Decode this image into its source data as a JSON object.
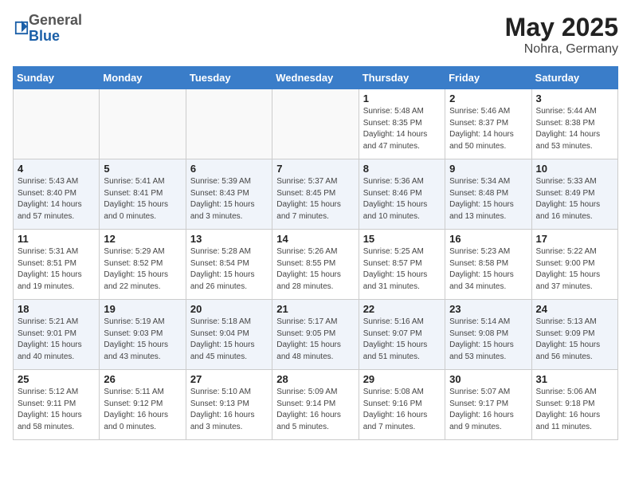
{
  "header": {
    "logo_general": "General",
    "logo_blue": "Blue",
    "title": "May 2025",
    "subtitle": "Nohra, Germany"
  },
  "weekdays": [
    "Sunday",
    "Monday",
    "Tuesday",
    "Wednesday",
    "Thursday",
    "Friday",
    "Saturday"
  ],
  "weeks": [
    [
      {
        "day": "",
        "info": ""
      },
      {
        "day": "",
        "info": ""
      },
      {
        "day": "",
        "info": ""
      },
      {
        "day": "",
        "info": ""
      },
      {
        "day": "1",
        "info": "Sunrise: 5:48 AM\nSunset: 8:35 PM\nDaylight: 14 hours\nand 47 minutes."
      },
      {
        "day": "2",
        "info": "Sunrise: 5:46 AM\nSunset: 8:37 PM\nDaylight: 14 hours\nand 50 minutes."
      },
      {
        "day": "3",
        "info": "Sunrise: 5:44 AM\nSunset: 8:38 PM\nDaylight: 14 hours\nand 53 minutes."
      }
    ],
    [
      {
        "day": "4",
        "info": "Sunrise: 5:43 AM\nSunset: 8:40 PM\nDaylight: 14 hours\nand 57 minutes."
      },
      {
        "day": "5",
        "info": "Sunrise: 5:41 AM\nSunset: 8:41 PM\nDaylight: 15 hours\nand 0 minutes."
      },
      {
        "day": "6",
        "info": "Sunrise: 5:39 AM\nSunset: 8:43 PM\nDaylight: 15 hours\nand 3 minutes."
      },
      {
        "day": "7",
        "info": "Sunrise: 5:37 AM\nSunset: 8:45 PM\nDaylight: 15 hours\nand 7 minutes."
      },
      {
        "day": "8",
        "info": "Sunrise: 5:36 AM\nSunset: 8:46 PM\nDaylight: 15 hours\nand 10 minutes."
      },
      {
        "day": "9",
        "info": "Sunrise: 5:34 AM\nSunset: 8:48 PM\nDaylight: 15 hours\nand 13 minutes."
      },
      {
        "day": "10",
        "info": "Sunrise: 5:33 AM\nSunset: 8:49 PM\nDaylight: 15 hours\nand 16 minutes."
      }
    ],
    [
      {
        "day": "11",
        "info": "Sunrise: 5:31 AM\nSunset: 8:51 PM\nDaylight: 15 hours\nand 19 minutes."
      },
      {
        "day": "12",
        "info": "Sunrise: 5:29 AM\nSunset: 8:52 PM\nDaylight: 15 hours\nand 22 minutes."
      },
      {
        "day": "13",
        "info": "Sunrise: 5:28 AM\nSunset: 8:54 PM\nDaylight: 15 hours\nand 26 minutes."
      },
      {
        "day": "14",
        "info": "Sunrise: 5:26 AM\nSunset: 8:55 PM\nDaylight: 15 hours\nand 28 minutes."
      },
      {
        "day": "15",
        "info": "Sunrise: 5:25 AM\nSunset: 8:57 PM\nDaylight: 15 hours\nand 31 minutes."
      },
      {
        "day": "16",
        "info": "Sunrise: 5:23 AM\nSunset: 8:58 PM\nDaylight: 15 hours\nand 34 minutes."
      },
      {
        "day": "17",
        "info": "Sunrise: 5:22 AM\nSunset: 9:00 PM\nDaylight: 15 hours\nand 37 minutes."
      }
    ],
    [
      {
        "day": "18",
        "info": "Sunrise: 5:21 AM\nSunset: 9:01 PM\nDaylight: 15 hours\nand 40 minutes."
      },
      {
        "day": "19",
        "info": "Sunrise: 5:19 AM\nSunset: 9:03 PM\nDaylight: 15 hours\nand 43 minutes."
      },
      {
        "day": "20",
        "info": "Sunrise: 5:18 AM\nSunset: 9:04 PM\nDaylight: 15 hours\nand 45 minutes."
      },
      {
        "day": "21",
        "info": "Sunrise: 5:17 AM\nSunset: 9:05 PM\nDaylight: 15 hours\nand 48 minutes."
      },
      {
        "day": "22",
        "info": "Sunrise: 5:16 AM\nSunset: 9:07 PM\nDaylight: 15 hours\nand 51 minutes."
      },
      {
        "day": "23",
        "info": "Sunrise: 5:14 AM\nSunset: 9:08 PM\nDaylight: 15 hours\nand 53 minutes."
      },
      {
        "day": "24",
        "info": "Sunrise: 5:13 AM\nSunset: 9:09 PM\nDaylight: 15 hours\nand 56 minutes."
      }
    ],
    [
      {
        "day": "25",
        "info": "Sunrise: 5:12 AM\nSunset: 9:11 PM\nDaylight: 15 hours\nand 58 minutes."
      },
      {
        "day": "26",
        "info": "Sunrise: 5:11 AM\nSunset: 9:12 PM\nDaylight: 16 hours\nand 0 minutes."
      },
      {
        "day": "27",
        "info": "Sunrise: 5:10 AM\nSunset: 9:13 PM\nDaylight: 16 hours\nand 3 minutes."
      },
      {
        "day": "28",
        "info": "Sunrise: 5:09 AM\nSunset: 9:14 PM\nDaylight: 16 hours\nand 5 minutes."
      },
      {
        "day": "29",
        "info": "Sunrise: 5:08 AM\nSunset: 9:16 PM\nDaylight: 16 hours\nand 7 minutes."
      },
      {
        "day": "30",
        "info": "Sunrise: 5:07 AM\nSunset: 9:17 PM\nDaylight: 16 hours\nand 9 minutes."
      },
      {
        "day": "31",
        "info": "Sunrise: 5:06 AM\nSunset: 9:18 PM\nDaylight: 16 hours\nand 11 minutes."
      }
    ]
  ]
}
